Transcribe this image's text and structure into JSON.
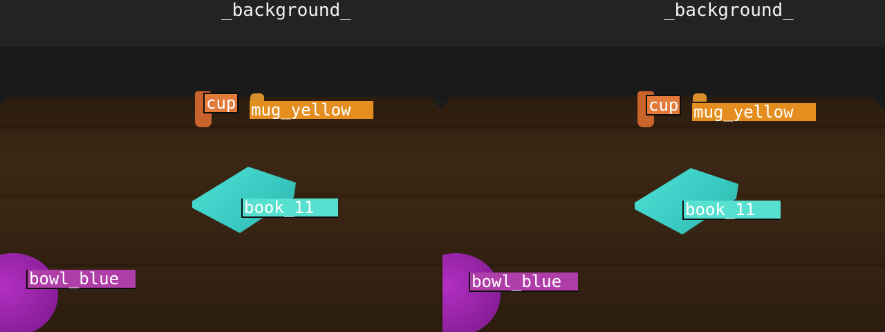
{
  "panels": [
    {
      "title": "_background_",
      "labels": {
        "cup": "cup",
        "mug": "mug_yellow",
        "book": "book_11",
        "bowl": "bowl_blue"
      }
    },
    {
      "title": "_background_",
      "labels": {
        "cup": "cup",
        "mug": "mug_yellow",
        "book": "book_11",
        "bowl": "bowl_blue"
      }
    }
  ],
  "colors": {
    "cup": "#e27a3a",
    "mug": "#e58e20",
    "book": "#57e0cf",
    "bowl": "#b03ea8"
  }
}
